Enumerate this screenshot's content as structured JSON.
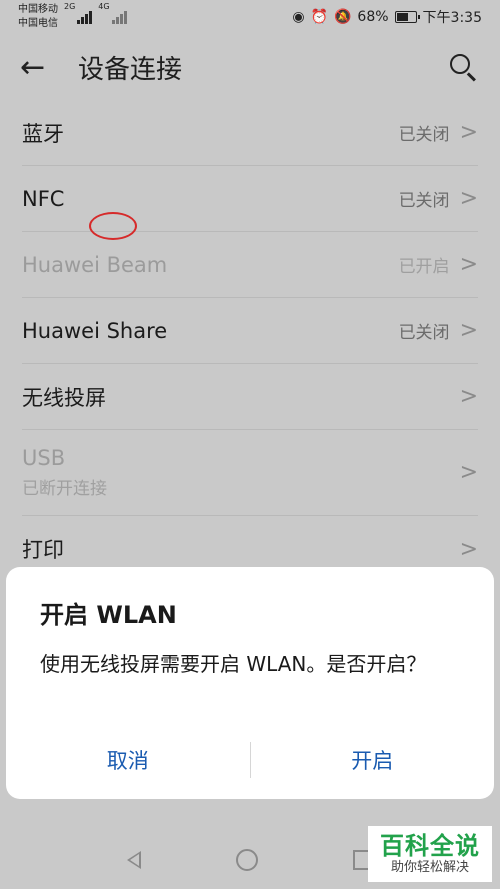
{
  "status": {
    "carrier1": "中国移动",
    "carrier2": "中国电信",
    "net1": "2G",
    "net2": "4G",
    "battery_pct": "68%",
    "battery_level": 0.68,
    "time": "下午3:35"
  },
  "header": {
    "back_icon": "←",
    "title": "设备连接"
  },
  "rows": [
    {
      "label": "蓝牙",
      "value": "已关闭",
      "chevron": ">"
    },
    {
      "label": "NFC",
      "value": "已关闭",
      "chevron": ">"
    },
    {
      "label": "Huawei Beam",
      "value": "已开启",
      "chevron": ">"
    },
    {
      "label": "Huawei Share",
      "value": "已关闭",
      "chevron": ">"
    },
    {
      "label": "无线投屏",
      "chevron": ">"
    },
    {
      "label": "USB",
      "sub": "已断开连接",
      "chevron": ">"
    },
    {
      "label": "打印",
      "chevron": ">"
    }
  ],
  "dialog": {
    "title": "开启 WLAN",
    "message": "使用无线投屏需要开启 WLAN。是否开启？",
    "cancel": "取消",
    "confirm": "开启"
  },
  "watermark": {
    "main": "百科全说",
    "sub": "助你轻松解决"
  },
  "colors": {
    "dialog_button": "#1a5bb0",
    "annotation": "#d62a2a",
    "watermark_green": "#22a24b"
  }
}
